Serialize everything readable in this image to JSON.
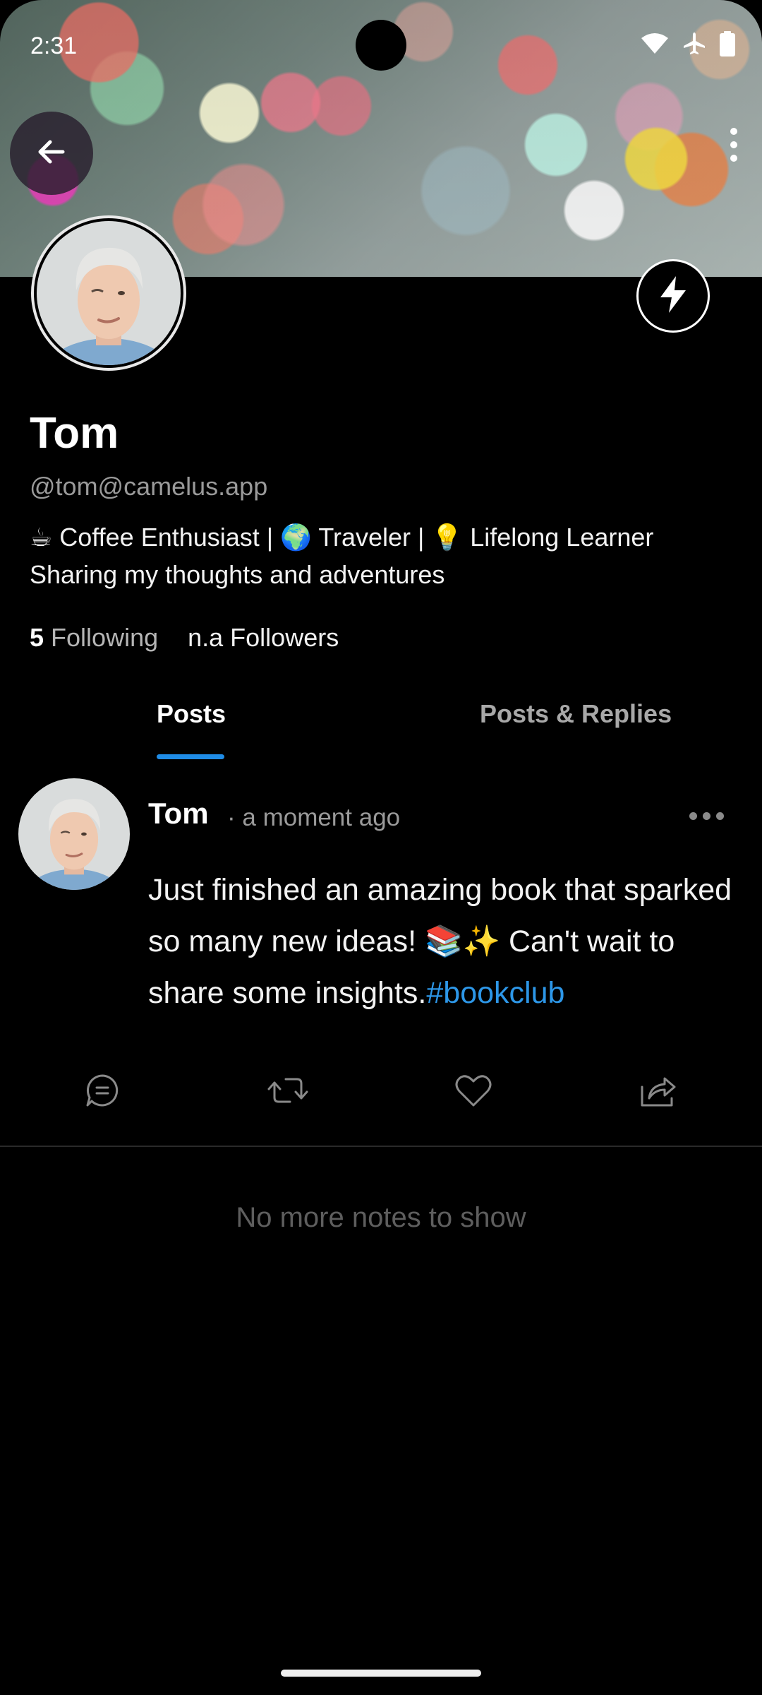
{
  "status_bar": {
    "time": "2:31",
    "icons": [
      "wifi-icon",
      "airplane-icon",
      "battery-icon"
    ]
  },
  "navigation": {
    "back_icon": "arrow-left-icon",
    "more_icon": "vertical-dots-icon"
  },
  "profile": {
    "name": "Tom",
    "handle": "@tom@camelus.app",
    "bio_lines": [
      "☕ Coffee Enthusiast | 🌍 Traveler | 💡 Lifelong Learner",
      "Sharing my thoughts and adventures"
    ],
    "following_count": "5",
    "following_label": "Following",
    "followers_text": "n.a Followers",
    "zap_icon": "lightning-icon"
  },
  "tabs": [
    {
      "label": "Posts",
      "active": true
    },
    {
      "label": "Posts & Replies",
      "active": false
    }
  ],
  "post": {
    "author": "Tom",
    "time": "· a moment ago",
    "text": "Just finished an amazing book that sparked so many new ideas! 📚✨ Can't wait to share some insights.",
    "hashtag": "#bookclub",
    "actions": [
      "reply-icon",
      "repost-icon",
      "like-icon",
      "share-icon"
    ]
  },
  "feed_end_message": "No more notes to show",
  "colors": {
    "accent": "#1f8ce6",
    "hashtag": "#2d97e8",
    "background": "#000000",
    "muted_text": "#9a9a9a"
  }
}
